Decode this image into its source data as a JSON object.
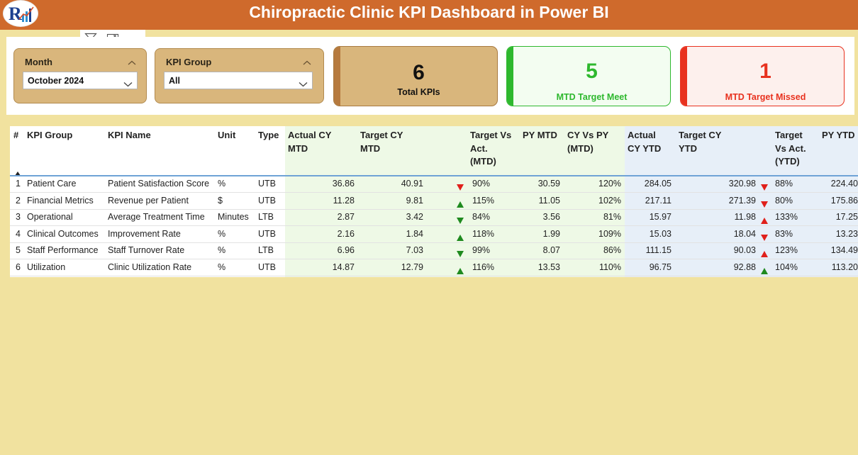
{
  "header": {
    "title": "Chiropractic Clinic KPI Dashboard in Power BI",
    "logo_icon": "kpi-logo-icon",
    "bg_color": "#cf6a2c"
  },
  "toolbar": {
    "filter_icon": "filter-icon",
    "focus_icon": "focus-mode-icon",
    "more_icon": "more-options-icon"
  },
  "slicers": {
    "month": {
      "label": "Month",
      "value": "October 2024"
    },
    "kpi_group": {
      "label": "KPI Group",
      "value": "All"
    }
  },
  "cards": {
    "total": {
      "value": "6",
      "label": "Total KPIs",
      "color": "#b67a3e"
    },
    "meet": {
      "value": "5",
      "label": "MTD Target Meet",
      "color": "#2eb82e"
    },
    "missed": {
      "value": "1",
      "label": "MTD Target Missed",
      "color": "#e8321f"
    }
  },
  "table": {
    "headers": {
      "num": "#",
      "group": "KPI Group",
      "name": "KPI Name",
      "unit": "Unit",
      "type": "Type",
      "actual_mtd": [
        "Actual CY",
        "MTD"
      ],
      "target_mtd": [
        "Target CY",
        "MTD"
      ],
      "tva_mtd": [
        "Target Vs",
        "Act.",
        "(MTD)"
      ],
      "py_mtd": "PY MTD",
      "cvp_mtd": [
        "CY Vs PY",
        "(MTD)"
      ],
      "actual_ytd": [
        "Actual",
        "CY YTD"
      ],
      "target_ytd": [
        "Target CY",
        "YTD"
      ],
      "tva_ytd": [
        "Target",
        "Vs Act.",
        "(YTD)"
      ],
      "py_ytd": "PY YTD"
    },
    "rows": [
      {
        "num": "1",
        "group": "Patient Care",
        "name": "Patient Satisfaction Score",
        "unit": "%",
        "type": "UTB",
        "actual_mtd": "36.86",
        "target_mtd": "40.91",
        "mtd_icon": "down",
        "tva_mtd": "90%",
        "py_mtd": "30.59",
        "cvp_mtd": "120%",
        "actual_ytd": "284.05",
        "target_ytd": "320.98",
        "ytd_icon": "down",
        "tva_ytd": "88%",
        "py_ytd": "224.40"
      },
      {
        "num": "2",
        "group": "Financial Metrics",
        "name": "Revenue per Patient",
        "unit": "$",
        "type": "UTB",
        "actual_mtd": "11.28",
        "target_mtd": "9.81",
        "mtd_icon": "up",
        "tva_mtd": "115%",
        "py_mtd": "11.05",
        "cvp_mtd": "102%",
        "actual_ytd": "217.11",
        "target_ytd": "271.39",
        "ytd_icon": "down",
        "tva_ytd": "80%",
        "py_ytd": "175.86"
      },
      {
        "num": "3",
        "group": "Operational",
        "name": "Average Treatment Time",
        "unit": "Minutes",
        "type": "LTB",
        "actual_mtd": "2.87",
        "target_mtd": "3.42",
        "mtd_icon": "down-good",
        "tva_mtd": "84%",
        "py_mtd": "3.56",
        "cvp_mtd": "81%",
        "actual_ytd": "15.97",
        "target_ytd": "11.98",
        "ytd_icon": "up-bad",
        "tva_ytd": "133%",
        "py_ytd": "17.25"
      },
      {
        "num": "4",
        "group": "Clinical Outcomes",
        "name": "Improvement Rate",
        "unit": "%",
        "type": "UTB",
        "actual_mtd": "2.16",
        "target_mtd": "1.84",
        "mtd_icon": "up",
        "tva_mtd": "118%",
        "py_mtd": "1.99",
        "cvp_mtd": "109%",
        "actual_ytd": "15.03",
        "target_ytd": "18.04",
        "ytd_icon": "down",
        "tva_ytd": "83%",
        "py_ytd": "13.23"
      },
      {
        "num": "5",
        "group": "Staff Performance",
        "name": "Staff Turnover Rate",
        "unit": "%",
        "type": "LTB",
        "actual_mtd": "6.96",
        "target_mtd": "7.03",
        "mtd_icon": "down-good",
        "tva_mtd": "99%",
        "py_mtd": "8.07",
        "cvp_mtd": "86%",
        "actual_ytd": "111.15",
        "target_ytd": "90.03",
        "ytd_icon": "up-bad",
        "tva_ytd": "123%",
        "py_ytd": "134.49"
      },
      {
        "num": "6",
        "group": "Utilization",
        "name": "Clinic Utilization Rate",
        "unit": "%",
        "type": "UTB",
        "actual_mtd": "14.87",
        "target_mtd": "12.79",
        "mtd_icon": "up",
        "tva_mtd": "116%",
        "py_mtd": "13.53",
        "cvp_mtd": "110%",
        "actual_ytd": "96.75",
        "target_ytd": "92.88",
        "ytd_icon": "up",
        "tva_ytd": "104%",
        "py_ytd": "113.20"
      }
    ]
  },
  "colors": {
    "good": "#1f8a1f",
    "bad": "#e0201b",
    "page_bg": "#f1e29f",
    "mtd_bg": "#eef9e6",
    "ytd_bg": "#e7eff8"
  }
}
